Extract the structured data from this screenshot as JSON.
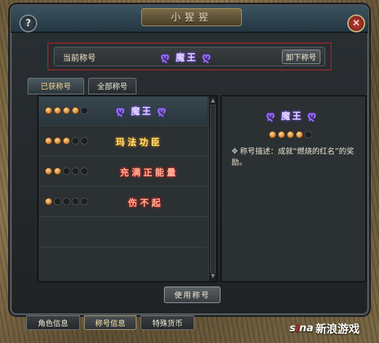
{
  "window": {
    "title": "小猩猩"
  },
  "current": {
    "label": "当前称号",
    "title": "魔王",
    "unequip": "卸下称号"
  },
  "tabs": [
    {
      "label": "已获称号",
      "active": true
    },
    {
      "label": "全部称号",
      "active": false
    }
  ],
  "list": [
    {
      "title": "魔王",
      "stars": 4,
      "style": "purple",
      "selected": true
    },
    {
      "title": "玛法功臣",
      "stars": 3,
      "style": "gold",
      "selected": false
    },
    {
      "title": "充满正能量",
      "stars": 2,
      "style": "red",
      "selected": false
    },
    {
      "title": "伤不起",
      "stars": 1,
      "style": "red",
      "selected": false
    }
  ],
  "detail": {
    "title": "魔王",
    "stars": 4,
    "description": "称号描述：成就“燃烧的红名”的奖励。"
  },
  "use_button": "使用称号",
  "bottom_tabs": [
    {
      "label": "角色信息",
      "active": false
    },
    {
      "label": "称号信息",
      "active": true
    },
    {
      "label": "特殊货币",
      "active": false
    }
  ],
  "watermark": {
    "logo": "sina",
    "text": "新浪游戏"
  },
  "colors": {
    "star_on": "#d38a3a",
    "purple_glow": "#8a5bff",
    "gold": "#ffe27a",
    "red_glow": "#ff2a10",
    "highlight_border": "#c0282a"
  }
}
